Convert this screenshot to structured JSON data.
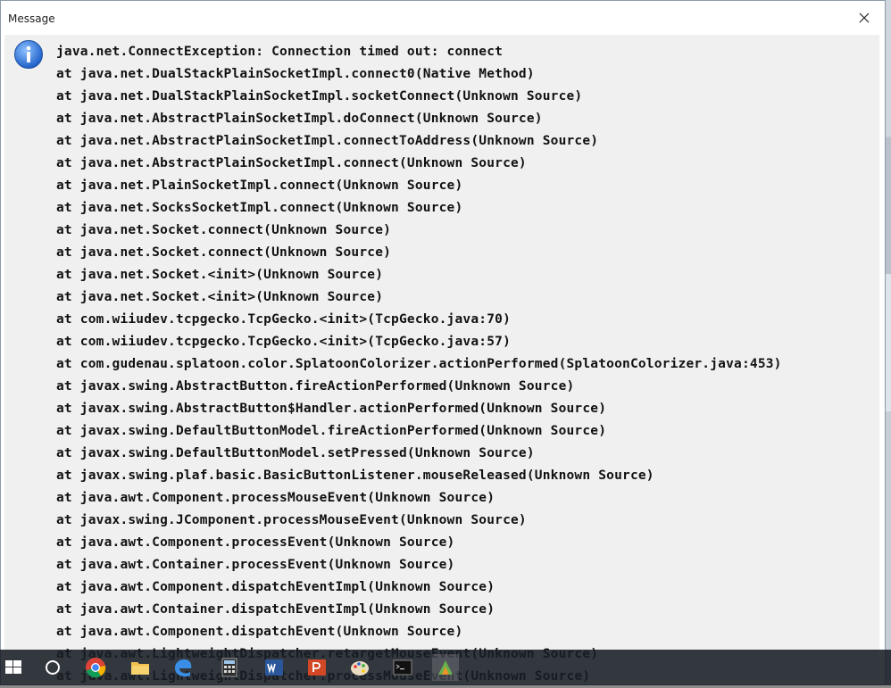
{
  "window": {
    "title": "Message",
    "close_label": "×"
  },
  "message": {
    "icon": "info-icon",
    "lines": [
      "java.net.ConnectException: Connection timed out: connect",
      "at java.net.DualStackPlainSocketImpl.connect0(Native Method)",
      "at java.net.DualStackPlainSocketImpl.socketConnect(Unknown Source)",
      "at java.net.AbstractPlainSocketImpl.doConnect(Unknown Source)",
      "at java.net.AbstractPlainSocketImpl.connectToAddress(Unknown Source)",
      "at java.net.AbstractPlainSocketImpl.connect(Unknown Source)",
      "at java.net.PlainSocketImpl.connect(Unknown Source)",
      "at java.net.SocksSocketImpl.connect(Unknown Source)",
      "at java.net.Socket.connect(Unknown Source)",
      "at java.net.Socket.connect(Unknown Source)",
      "at java.net.Socket.<init>(Unknown Source)",
      "at java.net.Socket.<init>(Unknown Source)",
      "at com.wiiudev.tcpgecko.TcpGecko.<init>(TcpGecko.java:70)",
      "at com.wiiudev.tcpgecko.TcpGecko.<init>(TcpGecko.java:57)",
      "at com.gudenau.splatoon.color.SplatoonColorizer.actionPerformed(SplatoonColorizer.java:453)",
      "at javax.swing.AbstractButton.fireActionPerformed(Unknown Source)",
      "at javax.swing.AbstractButton$Handler.actionPerformed(Unknown Source)",
      "at javax.swing.DefaultButtonModel.fireActionPerformed(Unknown Source)",
      "at javax.swing.DefaultButtonModel.setPressed(Unknown Source)",
      "at javax.swing.plaf.basic.BasicButtonListener.mouseReleased(Unknown Source)",
      "at java.awt.Component.processMouseEvent(Unknown Source)",
      "at javax.swing.JComponent.processMouseEvent(Unknown Source)",
      "at java.awt.Component.processEvent(Unknown Source)",
      "at java.awt.Container.processEvent(Unknown Source)",
      "at java.awt.Component.dispatchEventImpl(Unknown Source)",
      "at java.awt.Container.dispatchEventImpl(Unknown Source)",
      "at java.awt.Component.dispatchEvent(Unknown Source)",
      "at java.awt.LightweightDispatcher.retargetMouseEvent(Unknown Source)",
      "at java.awt.LightweightDispatcher.processMouseEvent(Unknown Source)"
    ]
  },
  "taskbar": {
    "items": [
      {
        "name": "start-button",
        "icon": "windows-logo-icon"
      },
      {
        "name": "cortana-button",
        "icon": "cortana-circle-icon"
      },
      {
        "name": "chrome-button",
        "icon": "chrome-icon"
      },
      {
        "name": "file-explorer-button",
        "icon": "folder-icon"
      },
      {
        "name": "edge-button",
        "icon": "edge-icon"
      },
      {
        "name": "calculator-button",
        "icon": "calculator-icon"
      },
      {
        "name": "word-button",
        "icon": "word-icon"
      },
      {
        "name": "powerpoint-button",
        "icon": "powerpoint-icon"
      },
      {
        "name": "paint-button",
        "icon": "paint-palette-icon"
      },
      {
        "name": "command-prompt-button",
        "icon": "terminal-icon"
      },
      {
        "name": "colorizer-app-button",
        "icon": "app-icon"
      }
    ]
  },
  "colors": {
    "info_blue": "#2a6fd6",
    "taskbar": "#181c24",
    "dialog_bg": "#f0f0f0"
  }
}
